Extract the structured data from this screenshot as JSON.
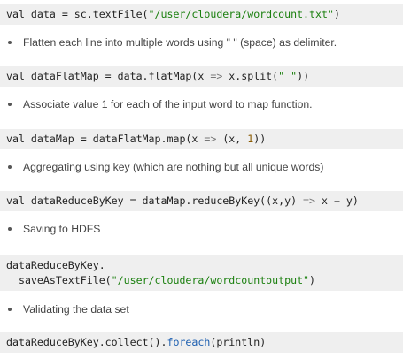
{
  "blocks": [
    {
      "type": "code",
      "lines": [
        [
          {
            "t": "val data = sc.textFile(",
            "c": ""
          },
          {
            "t": "\"/user/cloudera/wordcount.txt\"",
            "c": "s"
          },
          {
            "t": ")",
            "c": ""
          }
        ]
      ]
    },
    {
      "type": "bullet",
      "text": "Flatten each line into multiple words using \" \" (space) as delimiter."
    },
    {
      "type": "code",
      "lines": [
        [
          {
            "t": "val dataFlatMap = data.flatMap(x ",
            "c": ""
          },
          {
            "t": "=>",
            "c": "o"
          },
          {
            "t": " x.split(",
            "c": ""
          },
          {
            "t": "\" \"",
            "c": "s"
          },
          {
            "t": "))",
            "c": ""
          }
        ]
      ]
    },
    {
      "type": "bullet",
      "text": "Associate value 1 for each of the input word to map function."
    },
    {
      "type": "code",
      "lines": [
        [
          {
            "t": "val dataMap = dataFlatMap.map(x ",
            "c": ""
          },
          {
            "t": "=>",
            "c": "o"
          },
          {
            "t": " (x, ",
            "c": ""
          },
          {
            "t": "1",
            "c": "n"
          },
          {
            "t": "))",
            "c": ""
          }
        ]
      ]
    },
    {
      "type": "bullet",
      "text": "Aggregating using key (which are nothing but all unique words)"
    },
    {
      "type": "code",
      "lines": [
        [
          {
            "t": "val dataReduceByKey = dataMap.reduceByKey((x,y) ",
            "c": ""
          },
          {
            "t": "=>",
            "c": "o"
          },
          {
            "t": " x ",
            "c": ""
          },
          {
            "t": "+",
            "c": "o"
          },
          {
            "t": " y)",
            "c": ""
          }
        ]
      ]
    },
    {
      "type": "bullet",
      "text": "Saving to HDFS"
    },
    {
      "type": "code",
      "lines": [
        [
          {
            "t": "dataReduceByKey.",
            "c": ""
          }
        ],
        [
          {
            "t": "  saveAsTextFile(",
            "c": ""
          },
          {
            "t": "\"/user/cloudera/wordcountoutput\"",
            "c": "s"
          },
          {
            "t": ")",
            "c": ""
          }
        ]
      ]
    },
    {
      "type": "bullet",
      "text": "Validating the data set"
    },
    {
      "type": "code",
      "lines": [
        [
          {
            "t": "dataReduceByKey.collect().",
            "c": ""
          },
          {
            "t": "foreach",
            "c": "m"
          },
          {
            "t": "(println)",
            "c": ""
          }
        ]
      ]
    }
  ]
}
